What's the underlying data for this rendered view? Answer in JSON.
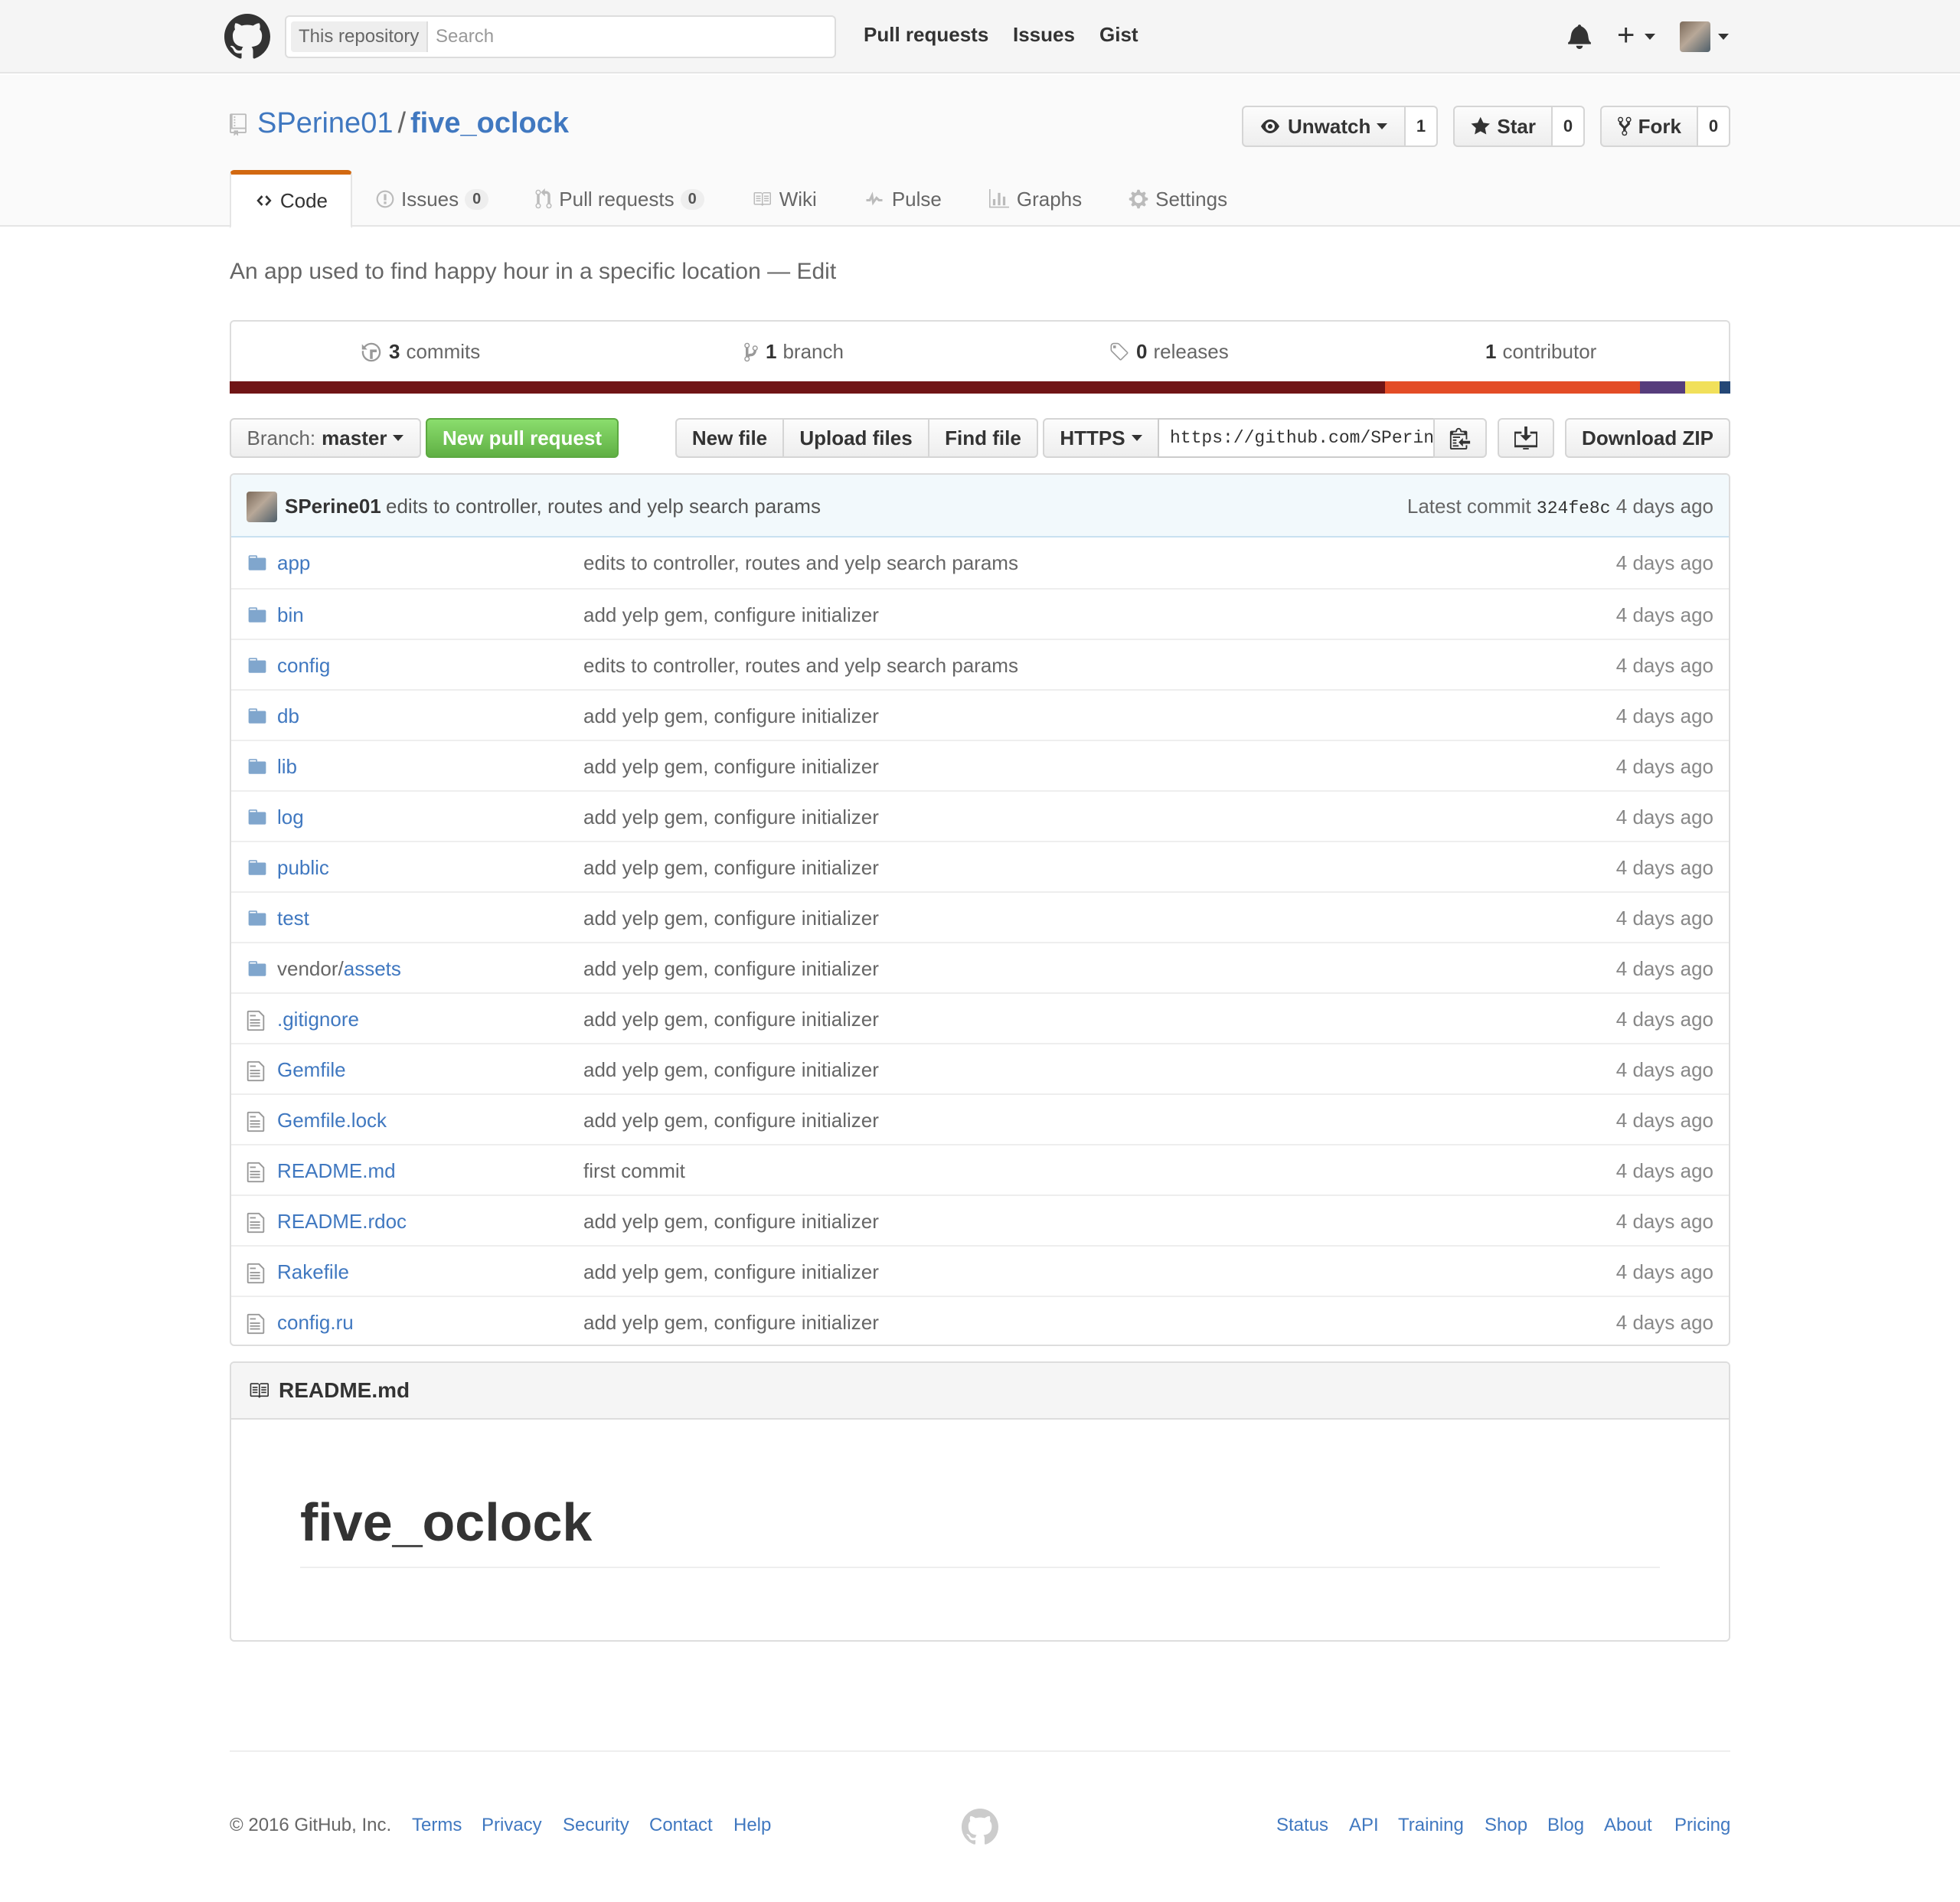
{
  "header": {
    "scope_label": "This repository",
    "search_placeholder": "Search",
    "nav": [
      "Pull requests",
      "Issues",
      "Gist"
    ],
    "plus_label": "+"
  },
  "repo": {
    "owner": "SPerine01",
    "separator": "/",
    "name": "five_oclock",
    "unwatch_label": "Unwatch",
    "watch_count": "1",
    "star_label": "Star",
    "star_count": "0",
    "fork_label": "Fork",
    "fork_count": "0"
  },
  "tabs": [
    {
      "label": "Code",
      "icon": "code-icon"
    },
    {
      "label": "Issues",
      "count": "0",
      "icon": "issue-icon"
    },
    {
      "label": "Pull requests",
      "count": "0",
      "icon": "pull-request-icon"
    },
    {
      "label": "Wiki",
      "icon": "wiki-icon"
    },
    {
      "label": "Pulse",
      "icon": "pulse-icon"
    },
    {
      "label": "Graphs",
      "icon": "graph-icon"
    },
    {
      "label": "Settings",
      "icon": "gear-icon"
    }
  ],
  "description": {
    "text": "An app used to find happy hour in a specific location",
    "dash": "—",
    "edit": "Edit"
  },
  "summary": {
    "commits_num": "3",
    "commits_label": "commits",
    "branch_num": "1",
    "branch_label": "branch",
    "releases_num": "0",
    "releases_label": "releases",
    "contributor_num": "1",
    "contributor_label": "contributor"
  },
  "languages": [
    {
      "color": "#701516",
      "share": 77
    },
    {
      "color": "#e34c26",
      "share": 17
    },
    {
      "color": "#563d7c",
      "share": 3
    },
    {
      "color": "#f1e05a",
      "share": 2.3
    },
    {
      "color": "#244776",
      "share": 0.7
    }
  ],
  "file_nav": {
    "branch_label": "Branch:",
    "branch_name": "master",
    "new_pr": "New pull request",
    "new_file": "New file",
    "upload": "Upload files",
    "find": "Find file",
    "protocol": "HTTPS",
    "clone_url": "https://github.com/SPerin",
    "download": "Download ZIP"
  },
  "commit": {
    "author": "SPerine01",
    "message": "edits to controller, routes and yelp search params",
    "latest_label": "Latest commit",
    "sha": "324fe8c",
    "age": "4 days ago"
  },
  "files": [
    {
      "name": "app",
      "type": "dir",
      "message": "edits to controller, routes and yelp search params",
      "age": "4 days ago"
    },
    {
      "name": "bin",
      "type": "dir",
      "message": "add yelp gem, configure initializer",
      "age": "4 days ago"
    },
    {
      "name": "config",
      "type": "dir",
      "message": "edits to controller, routes and yelp search params",
      "age": "4 days ago"
    },
    {
      "name": "db",
      "type": "dir",
      "message": "add yelp gem, configure initializer",
      "age": "4 days ago"
    },
    {
      "name": "lib",
      "type": "dir",
      "message": "add yelp gem, configure initializer",
      "age": "4 days ago"
    },
    {
      "name": "log",
      "type": "dir",
      "message": "add yelp gem, configure initializer",
      "age": "4 days ago"
    },
    {
      "name": "public",
      "type": "dir",
      "message": "add yelp gem, configure initializer",
      "age": "4 days ago"
    },
    {
      "name": "test",
      "type": "dir",
      "message": "add yelp gem, configure initializer",
      "age": "4 days ago"
    },
    {
      "name": "assets",
      "prefix": "vendor/",
      "type": "dir",
      "message": "add yelp gem, configure initializer",
      "age": "4 days ago"
    },
    {
      "name": ".gitignore",
      "type": "file",
      "message": "add yelp gem, configure initializer",
      "age": "4 days ago"
    },
    {
      "name": "Gemfile",
      "type": "file",
      "message": "add yelp gem, configure initializer",
      "age": "4 days ago"
    },
    {
      "name": "Gemfile.lock",
      "type": "file",
      "message": "add yelp gem, configure initializer",
      "age": "4 days ago"
    },
    {
      "name": "README.md",
      "type": "file",
      "message": "first commit",
      "age": "4 days ago"
    },
    {
      "name": "README.rdoc",
      "type": "file",
      "message": "add yelp gem, configure initializer",
      "age": "4 days ago"
    },
    {
      "name": "Rakefile",
      "type": "file",
      "message": "add yelp gem, configure initializer",
      "age": "4 days ago"
    },
    {
      "name": "config.ru",
      "type": "file",
      "message": "add yelp gem, configure initializer",
      "age": "4 days ago"
    }
  ],
  "readme": {
    "filename": "README.md",
    "heading": "five_oclock"
  },
  "footer": {
    "copyright": "© 2016 GitHub, Inc.",
    "left_links": [
      "Terms",
      "Privacy",
      "Security",
      "Contact",
      "Help"
    ],
    "right_links": [
      "Status",
      "API",
      "Training",
      "Shop",
      "Blog",
      "About",
      "Pricing"
    ]
  }
}
